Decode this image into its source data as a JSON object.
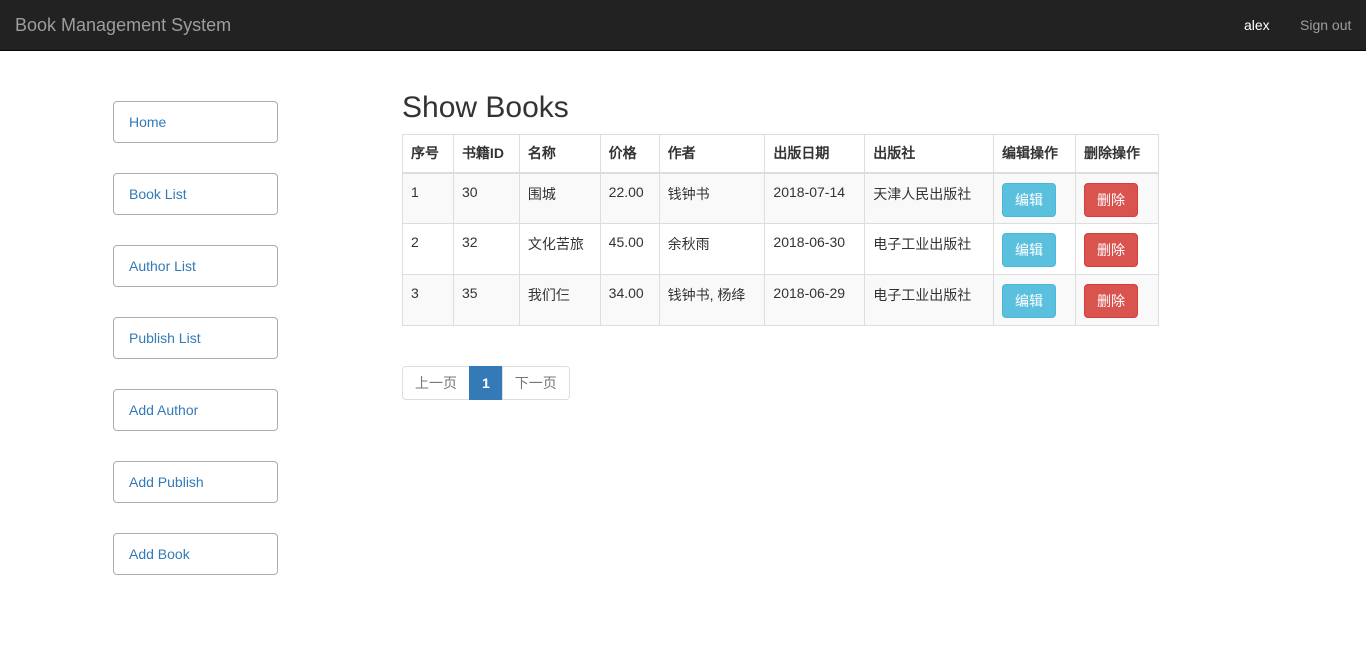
{
  "navbar": {
    "brand": "Book Management System",
    "user": "alex",
    "signout": "Sign out"
  },
  "sidebar": {
    "items": [
      {
        "label": "Home"
      },
      {
        "label": "Book List"
      },
      {
        "label": "Author List"
      },
      {
        "label": "Publish List"
      },
      {
        "label": "Add Author"
      },
      {
        "label": "Add Publish"
      },
      {
        "label": "Add Book"
      }
    ]
  },
  "main": {
    "title": "Show Books",
    "table": {
      "headers": [
        "序号",
        "书籍ID",
        "名称",
        "价格",
        "作者",
        "出版日期",
        "出版社",
        "编辑操作",
        "删除操作"
      ],
      "rows": [
        {
          "index": "1",
          "id": "30",
          "name": "围城",
          "price": "22.00",
          "author": "钱钟书",
          "date": "2018-07-14",
          "publisher": "天津人民出版社",
          "edit": "编辑",
          "delete": "删除"
        },
        {
          "index": "2",
          "id": "32",
          "name": "文化苦旅",
          "price": "45.00",
          "author": "余秋雨",
          "date": "2018-06-30",
          "publisher": "电子工业出版社",
          "edit": "编辑",
          "delete": "删除"
        },
        {
          "index": "3",
          "id": "35",
          "name": "我们仨",
          "price": "34.00",
          "author": "钱钟书, 杨绛",
          "date": "2018-06-29",
          "publisher": "电子工业出版社",
          "edit": "编辑",
          "delete": "删除"
        }
      ]
    },
    "pagination": {
      "prev": "上一页",
      "current": "1",
      "next": "下一页"
    }
  },
  "colors": {
    "navbar_bg": "#222222",
    "link": "#337ab7",
    "edit_button": "#5bc0de",
    "delete_button": "#d9534f",
    "active_page": "#337ab7"
  }
}
